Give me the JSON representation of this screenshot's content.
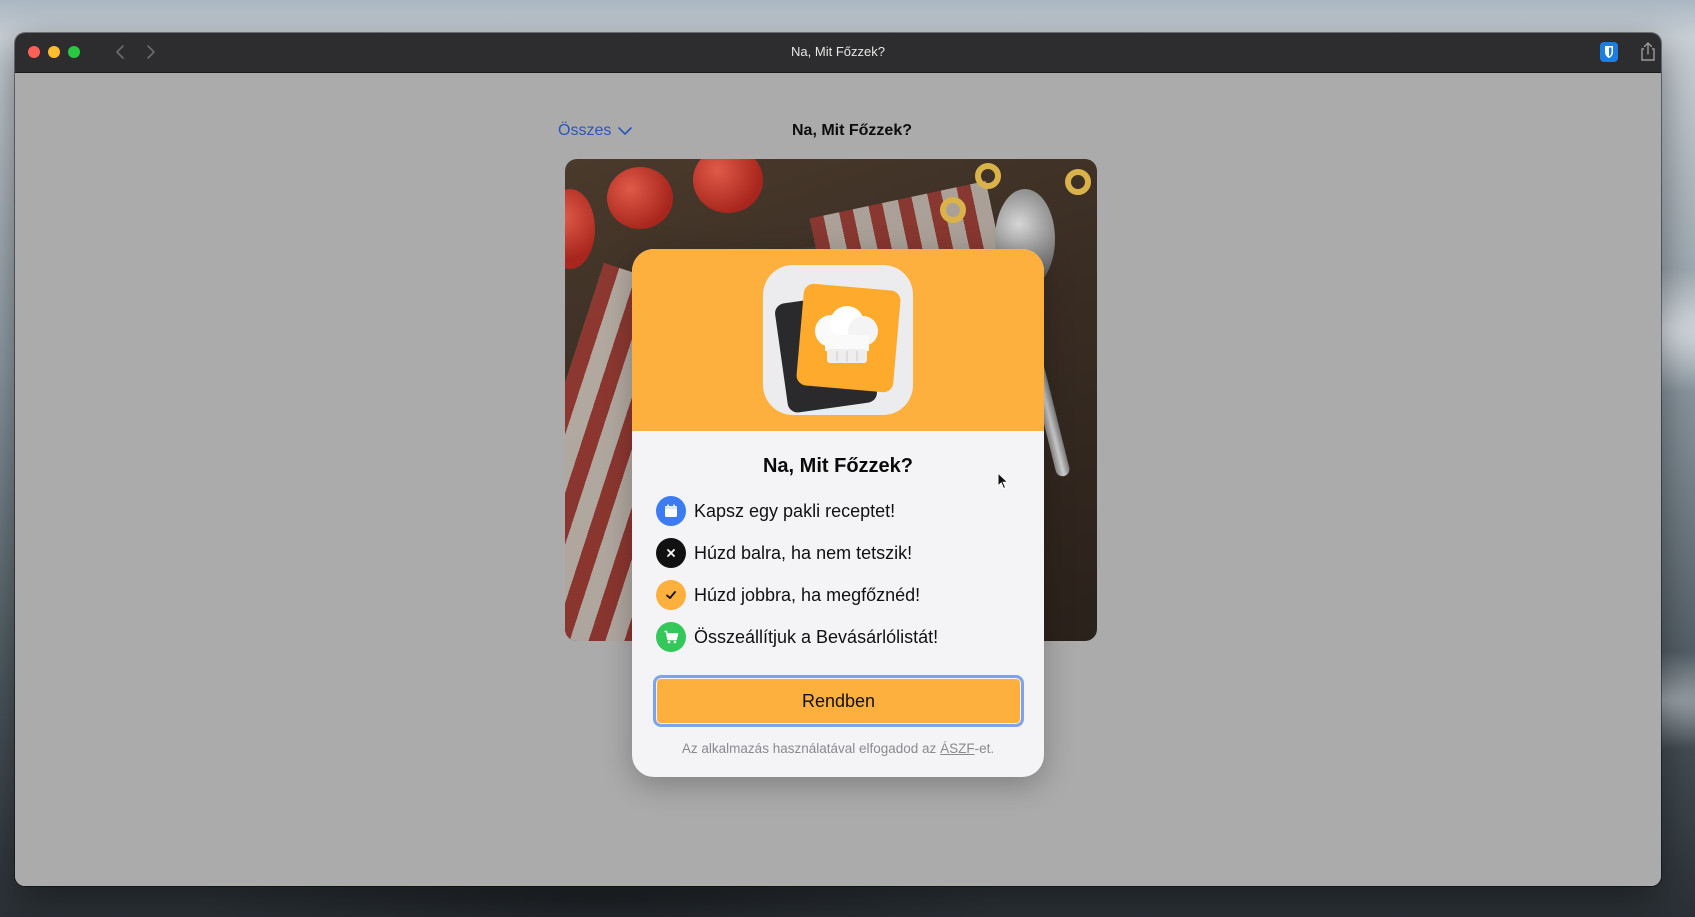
{
  "window": {
    "title": "Na, Mit Főzzek?"
  },
  "toolbar": {
    "filter_label": "Összes",
    "page_title": "Na, Mit Főzzek?"
  },
  "dialog": {
    "title": "Na, Mit Főzzek?",
    "features": [
      {
        "text": "Kapsz egy pakli receptet!",
        "icon": "calendar-icon",
        "color": "#3d7bf0"
      },
      {
        "text": "Húzd balra, ha nem tetszik!",
        "icon": "close-icon",
        "color": "#111111"
      },
      {
        "text": "Húzd jobbra, ha megfőznéd!",
        "icon": "checkmark-icon",
        "color": "#fdb03d"
      },
      {
        "text": "Összeállítjuk a Bevásárlólistát!",
        "icon": "cart-icon",
        "color": "#34c759"
      }
    ],
    "button_label": "Rendben",
    "footnote_prefix": "Az alkalmazás használatával elfogadod az ",
    "footnote_link": "ÁSZF",
    "footnote_suffix": "-et."
  },
  "colors": {
    "accent": "#fdb03d",
    "link": "#2c55b8",
    "focus_ring": "#7fa3ea"
  }
}
